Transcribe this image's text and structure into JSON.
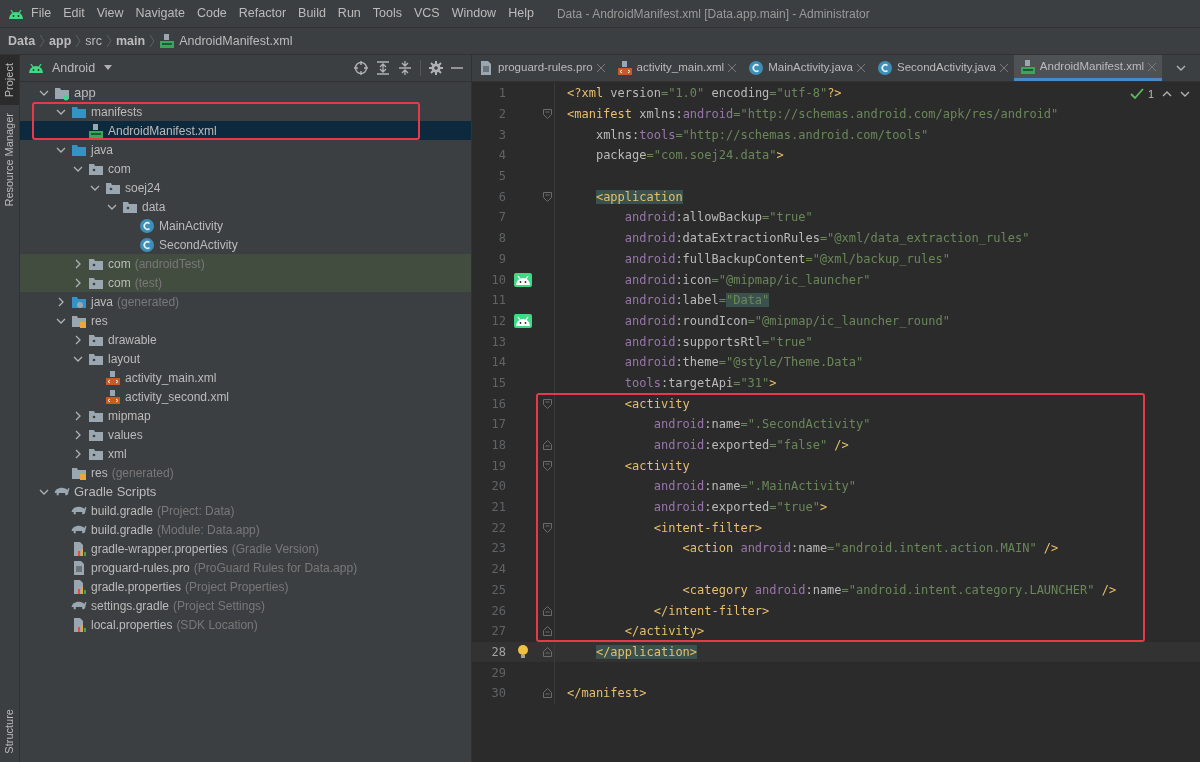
{
  "menu_bar": {
    "items": [
      "File",
      "Edit",
      "View",
      "Navigate",
      "Code",
      "Refactor",
      "Build",
      "Run",
      "Tools",
      "VCS",
      "Window",
      "Help"
    ],
    "title": "Data - AndroidManifest.xml [Data.app.main] - Administrator"
  },
  "breadcrumb": [
    {
      "label": "Data",
      "bold": true
    },
    {
      "label": "app",
      "bold": true
    },
    {
      "label": "src",
      "bold": false
    },
    {
      "label": "main",
      "bold": true
    },
    {
      "label": "AndroidManifest.xml",
      "bold": false,
      "kind": "manifest"
    }
  ],
  "tool_strip": [
    {
      "label": "Project",
      "selected": true
    },
    {
      "label": "Resource Manager",
      "selected": false
    },
    {
      "label": "Structure",
      "selected": false
    }
  ],
  "project_panel": {
    "view": "Android",
    "tree": [
      {
        "name": "app",
        "kind": "module",
        "expanded": true,
        "selected": false,
        "children": [
          {
            "name": "manifests",
            "kind": "source_folder",
            "expanded": true,
            "selected": false,
            "boxed": true,
            "children": [
              {
                "name": "AndroidManifest.xml",
                "kind": "manifest",
                "selected": true
              }
            ]
          },
          {
            "name": "java",
            "kind": "source_folder",
            "expanded": true,
            "selected": false,
            "children": [
              {
                "name": "com",
                "kind": "package",
                "expanded": true,
                "selected": false,
                "children": [
                  {
                    "name": "soej24",
                    "kind": "package",
                    "expanded": true,
                    "selected": false,
                    "children": [
                      {
                        "name": "data",
                        "kind": "package",
                        "expanded": true,
                        "selected": false,
                        "children": [
                          {
                            "name": "MainActivity",
                            "kind": "class",
                            "selected": false
                          },
                          {
                            "name": "SecondActivity",
                            "kind": "class",
                            "selected": false
                          }
                        ]
                      }
                    ]
                  }
                ]
              },
              {
                "name": "com",
                "suffix": "(androidTest)",
                "kind": "package",
                "expanded": false,
                "selected": false,
                "test": true
              },
              {
                "name": "com",
                "suffix": "(test)",
                "kind": "package",
                "expanded": false,
                "selected": false,
                "test": true
              }
            ]
          },
          {
            "name": "java",
            "suffix": "(generated)",
            "kind": "generated_folder",
            "expanded": false,
            "selected": false
          },
          {
            "name": "res",
            "kind": "res_folder",
            "expanded": true,
            "selected": false,
            "children": [
              {
                "name": "drawable",
                "kind": "package",
                "expanded": false,
                "selected": false
              },
              {
                "name": "layout",
                "kind": "package",
                "expanded": true,
                "selected": false,
                "children": [
                  {
                    "name": "activity_main.xml",
                    "kind": "layout_xml",
                    "selected": false
                  },
                  {
                    "name": "activity_second.xml",
                    "kind": "layout_xml",
                    "selected": false
                  }
                ]
              },
              {
                "name": "mipmap",
                "kind": "package",
                "expanded": false,
                "selected": false
              },
              {
                "name": "values",
                "kind": "package",
                "expanded": false,
                "selected": false
              },
              {
                "name": "xml",
                "kind": "package",
                "expanded": false,
                "selected": false
              }
            ]
          },
          {
            "name": "res",
            "suffix": "(generated)",
            "kind": "res_folder",
            "selected": false
          }
        ]
      },
      {
        "name": "Gradle Scripts",
        "kind": "gradle",
        "expanded": true,
        "selected": false,
        "children": [
          {
            "name": "build.gradle",
            "suffix": "(Project: Data)",
            "kind": "gradle",
            "selected": false
          },
          {
            "name": "build.gradle",
            "suffix": "(Module: Data.app)",
            "kind": "gradle",
            "selected": false
          },
          {
            "name": "gradle-wrapper.properties",
            "suffix": "(Gradle Version)",
            "kind": "properties",
            "selected": false
          },
          {
            "name": "proguard-rules.pro",
            "suffix": "(ProGuard Rules for Data.app)",
            "kind": "text_file",
            "selected": false
          },
          {
            "name": "gradle.properties",
            "suffix": "(Project Properties)",
            "kind": "properties",
            "selected": false
          },
          {
            "name": "settings.gradle",
            "suffix": "(Project Settings)",
            "kind": "gradle",
            "selected": false
          },
          {
            "name": "local.properties",
            "suffix": "(SDK Location)",
            "kind": "properties",
            "selected": false
          }
        ]
      }
    ]
  },
  "editor_tabs": [
    {
      "label": "proguard-rules.pro",
      "kind": "text_file",
      "selected": false
    },
    {
      "label": "activity_main.xml",
      "kind": "layout_xml",
      "selected": false
    },
    {
      "label": "MainActivity.java",
      "kind": "class",
      "selected": false
    },
    {
      "label": "SecondActivity.java",
      "kind": "class",
      "selected": false
    },
    {
      "label": "AndroidManifest.xml",
      "kind": "manifest",
      "selected": true
    }
  ],
  "inspection": {
    "count": "1"
  },
  "editor": {
    "lines": [
      {
        "number": "1",
        "current": false,
        "tokens": [
          {
            "kind": "tag",
            "text": "<?xml"
          },
          {
            "kind": "attr",
            "text": " version"
          },
          {
            "kind": "value",
            "text": "=\"1.0\""
          },
          {
            "kind": "attr",
            "text": " encoding"
          },
          {
            "kind": "value",
            "text": "=\"utf-8\""
          },
          {
            "kind": "tag",
            "text": "?>"
          }
        ]
      },
      {
        "number": "2",
        "current": false,
        "fold": {
          "kind": "start"
        },
        "tokens": [
          {
            "kind": "tag",
            "text": "<manifest"
          },
          {
            "kind": "attr",
            "text": " xmlns:"
          },
          {
            "kind": "ns",
            "text": "android"
          },
          {
            "kind": "value",
            "text": "=\"http://schemas.android.com/apk/res/android\""
          }
        ]
      },
      {
        "number": "3",
        "current": false,
        "tokens": [
          {
            "kind": "attr",
            "text": "    xmlns:"
          },
          {
            "kind": "ns",
            "text": "tools"
          },
          {
            "kind": "value",
            "text": "=\"http://schemas.android.com/tools\""
          }
        ]
      },
      {
        "number": "4",
        "current": false,
        "tokens": [
          {
            "kind": "attr",
            "text": "    package"
          },
          {
            "kind": "value",
            "text": "=\"com.soej24.data\""
          },
          {
            "kind": "tag",
            "text": ">"
          }
        ]
      },
      {
        "number": "5",
        "current": false
      },
      {
        "number": "6",
        "current": false,
        "fold": {
          "kind": "start"
        },
        "tokens": [
          {
            "kind": "tag",
            "text": "    <application",
            "highlighted": true
          }
        ]
      },
      {
        "number": "7",
        "current": false,
        "tokens": [
          {
            "kind": "ns",
            "text": "        android"
          },
          {
            "kind": "attr",
            "text": ":allowBackup"
          },
          {
            "kind": "value",
            "text": "=\"true\""
          }
        ]
      },
      {
        "number": "8",
        "current": false,
        "tokens": [
          {
            "kind": "ns",
            "text": "        android"
          },
          {
            "kind": "attr",
            "text": ":dataExtractionRules"
          },
          {
            "kind": "value",
            "text": "=\"@xml/data_extraction_rules\""
          }
        ]
      },
      {
        "number": "9",
        "current": false,
        "tokens": [
          {
            "kind": "ns",
            "text": "        android"
          },
          {
            "kind": "attr",
            "text": ":fullBackupContent"
          },
          {
            "kind": "value",
            "text": "=\"@xml/backup_rules\""
          }
        ]
      },
      {
        "number": "10",
        "current": false,
        "gutter": {
          "kind": "android"
        },
        "tokens": [
          {
            "kind": "ns",
            "text": "        android"
          },
          {
            "kind": "attr",
            "text": ":icon"
          },
          {
            "kind": "value",
            "text": "=\"@mipmap/ic_launcher\""
          }
        ]
      },
      {
        "number": "11",
        "current": false,
        "tokens": [
          {
            "kind": "ns",
            "text": "        android"
          },
          {
            "kind": "attr",
            "text": ":label"
          },
          {
            "kind": "value",
            "text": "="
          },
          {
            "kind": "value",
            "text": "\"Data\"",
            "highlighted": true
          }
        ]
      },
      {
        "number": "12",
        "current": false,
        "gutter": {
          "kind": "android"
        },
        "tokens": [
          {
            "kind": "ns",
            "text": "        android"
          },
          {
            "kind": "attr",
            "text": ":roundIcon"
          },
          {
            "kind": "value",
            "text": "=\"@mipmap/ic_launcher_round\""
          }
        ]
      },
      {
        "number": "13",
        "current": false,
        "tokens": [
          {
            "kind": "ns",
            "text": "        android"
          },
          {
            "kind": "attr",
            "text": ":supportsRtl"
          },
          {
            "kind": "value",
            "text": "=\"true\""
          }
        ]
      },
      {
        "number": "14",
        "current": false,
        "tokens": [
          {
            "kind": "ns",
            "text": "        android"
          },
          {
            "kind": "attr",
            "text": ":theme"
          },
          {
            "kind": "value",
            "text": "=\"@style/Theme.Data\""
          }
        ]
      },
      {
        "number": "15",
        "current": false,
        "tokens": [
          {
            "kind": "ns",
            "text": "        tools"
          },
          {
            "kind": "attr",
            "text": ":targetApi"
          },
          {
            "kind": "value",
            "text": "=\"31\""
          },
          {
            "kind": "tag",
            "text": ">"
          }
        ]
      },
      {
        "number": "16",
        "current": false,
        "fold": {
          "kind": "start"
        },
        "boxed": true,
        "tokens": [
          {
            "kind": "tag",
            "text": "        <activity"
          }
        ]
      },
      {
        "number": "17",
        "current": false,
        "boxed": true,
        "tokens": [
          {
            "kind": "ns",
            "text": "            android"
          },
          {
            "kind": "attr",
            "text": ":name"
          },
          {
            "kind": "value",
            "text": "=\".SecondActivity\""
          }
        ]
      },
      {
        "number": "18",
        "current": false,
        "fold": {
          "kind": "end"
        },
        "boxed": true,
        "tokens": [
          {
            "kind": "ns",
            "text": "            android"
          },
          {
            "kind": "attr",
            "text": ":exported"
          },
          {
            "kind": "value",
            "text": "=\"false\""
          },
          {
            "kind": "tag",
            "text": " />"
          }
        ]
      },
      {
        "number": "19",
        "current": false,
        "fold": {
          "kind": "start"
        },
        "boxed": true,
        "tokens": [
          {
            "kind": "tag",
            "text": "        <activity"
          }
        ]
      },
      {
        "number": "20",
        "current": false,
        "boxed": true,
        "tokens": [
          {
            "kind": "ns",
            "text": "            android"
          },
          {
            "kind": "attr",
            "text": ":name"
          },
          {
            "kind": "value",
            "text": "=\".MainActivity\""
          }
        ]
      },
      {
        "number": "21",
        "current": false,
        "boxed": true,
        "tokens": [
          {
            "kind": "ns",
            "text": "            android"
          },
          {
            "kind": "attr",
            "text": ":exported"
          },
          {
            "kind": "value",
            "text": "=\"true\""
          },
          {
            "kind": "tag",
            "text": ">"
          }
        ]
      },
      {
        "number": "22",
        "current": false,
        "fold": {
          "kind": "start"
        },
        "boxed": true,
        "tokens": [
          {
            "kind": "tag",
            "text": "            <intent-filter>"
          }
        ]
      },
      {
        "number": "23",
        "current": false,
        "boxed": true,
        "tokens": [
          {
            "kind": "tag",
            "text": "                <action"
          },
          {
            "kind": "ns",
            "text": " android"
          },
          {
            "kind": "attr",
            "text": ":name"
          },
          {
            "kind": "value",
            "text": "=\"android.intent.action.MAIN\""
          },
          {
            "kind": "tag",
            "text": " />"
          }
        ]
      },
      {
        "number": "24",
        "current": false,
        "boxed": true
      },
      {
        "number": "25",
        "current": false,
        "boxed": true,
        "tokens": [
          {
            "kind": "tag",
            "text": "                <category"
          },
          {
            "kind": "ns",
            "text": " android"
          },
          {
            "kind": "attr",
            "text": ":name"
          },
          {
            "kind": "value",
            "text": "=\"android.intent.category.LAUNCHER\""
          },
          {
            "kind": "tag",
            "text": " />"
          }
        ]
      },
      {
        "number": "26",
        "current": false,
        "fold": {
          "kind": "end"
        },
        "boxed": true,
        "tokens": [
          {
            "kind": "tag",
            "text": "            </intent-filter>"
          }
        ]
      },
      {
        "number": "27",
        "current": false,
        "fold": {
          "kind": "end"
        },
        "boxed": true,
        "tokens": [
          {
            "kind": "tag",
            "text": "        </activity>"
          }
        ]
      },
      {
        "number": "28",
        "current": true,
        "fold": {
          "kind": "end"
        },
        "gutter": {
          "kind": "bulb"
        },
        "tokens": [
          {
            "kind": "tag",
            "text": "    </application>",
            "highlighted": true
          }
        ]
      },
      {
        "number": "29",
        "current": false
      },
      {
        "number": "30",
        "current": false,
        "fold": {
          "kind": "end"
        },
        "tokens": [
          {
            "kind": "tag",
            "text": "</manifest>"
          }
        ]
      }
    ]
  }
}
